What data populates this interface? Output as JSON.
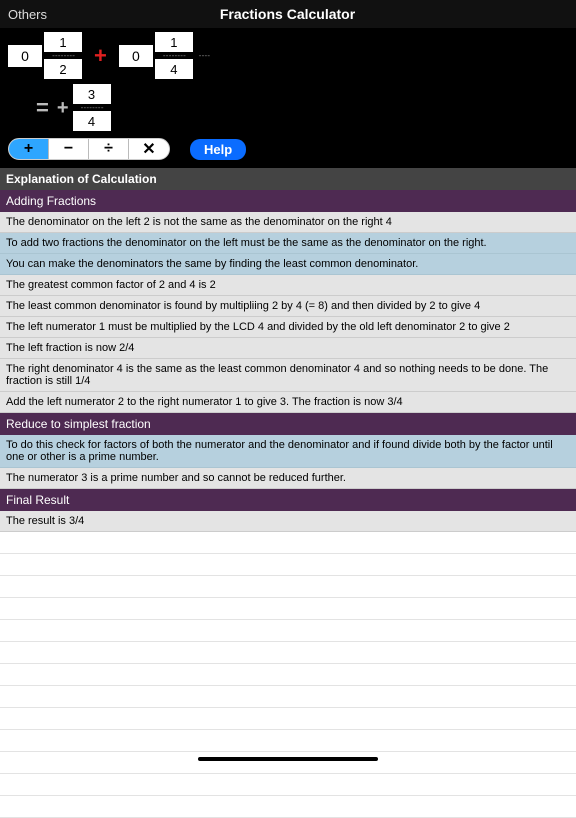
{
  "header": {
    "back": "Others",
    "title": "Fractions Calculator"
  },
  "fractions": {
    "left": {
      "whole": "0",
      "num": "1",
      "den": "2"
    },
    "right": {
      "whole": "0",
      "num": "1",
      "den": "4"
    },
    "op": "+",
    "result": {
      "eq": "=",
      "sign": "+",
      "num": "3",
      "den": "4"
    }
  },
  "ops": {
    "add": "+",
    "sub": "−",
    "div": "÷",
    "mul": "✕"
  },
  "help": "Help",
  "sections": {
    "explain": "Explanation of Calculation",
    "adding": "Adding Fractions",
    "reduce": "Reduce to simplest fraction",
    "final": "Final Result"
  },
  "lines": {
    "l1": "The denominator on the left 2 is not the same as the denominator on the right 4",
    "l2": "To add two fractions the denominator on the left must be the same as the denominator on the right.",
    "l3": "You can make the denominators the same by finding the least common denominator.",
    "l4": "The greatest common factor of 2 and 4 is 2",
    "l5": "The least common denominator is found by multipliing 2 by 4 (= 8) and then divided by 2 to give 4",
    "l6": "The left numerator 1 must be multiplied by the LCD 4 and divided by the old left denominator 2 to give 2",
    "l7": "The left fraction is now 2/4",
    "l8": "The right denominator 4 is the same as the least common denominator 4 and so nothing needs to be done.  The fraction is still 1/4",
    "l9": "Add the left numerator 2 to the right numerator 1 to give 3.  The fraction is now 3/4",
    "r1": "To do this check for factors of both the numerator and the denominator and if found divide both by the factor until one or other is a prime number.",
    "r2": "The numerator 3 is a prime number and so cannot be reduced further.",
    "f1": "The result is 3/4"
  }
}
